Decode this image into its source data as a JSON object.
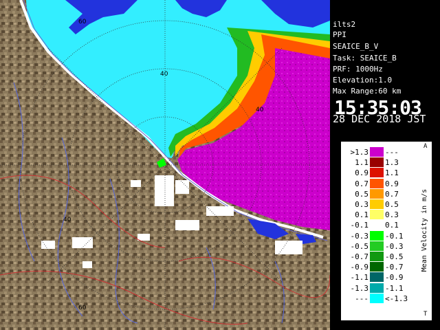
{
  "radar": {
    "ring_labels": [
      "60",
      "40",
      "40",
      "40",
      "60"
    ]
  },
  "info": {
    "site": "ilts2",
    "mode": "PPI",
    "product": "SEAICE_B_V",
    "task": "Task: SEAICE_B",
    "prf": "PRF: 1000Hz",
    "elevation": "Elevation:1.0",
    "max_range": "Max Range:60 km",
    "time": "15:35:03",
    "date": "28 DEC 2018 JST"
  },
  "legend": {
    "title": "Mean Velocity in m/s",
    "corner_top": "A",
    "corner_bottom": "T",
    "rows": [
      {
        "left": ">1.3",
        "right": "---",
        "color": "#cc00cc"
      },
      {
        "left": "1.1",
        "right": "1.3",
        "color": "#990000"
      },
      {
        "left": "0.9",
        "right": "1.1",
        "color": "#dd1100"
      },
      {
        "left": "0.7",
        "right": "0.9",
        "color": "#ff5500"
      },
      {
        "left": "0.5",
        "right": "0.7",
        "color": "#ff9900"
      },
      {
        "left": "0.3",
        "right": "0.5",
        "color": "#ffcc00"
      },
      {
        "left": "0.1",
        "right": "0.3",
        "color": "#ffff66"
      },
      {
        "left": "-0.1",
        "right": "0.1",
        "color": "#ffffff"
      },
      {
        "left": "-0.3",
        "right": "-0.1",
        "color": "#00ff00"
      },
      {
        "left": "-0.5",
        "right": "-0.3",
        "color": "#22cc22"
      },
      {
        "left": "-0.7",
        "right": "-0.5",
        "color": "#119911"
      },
      {
        "left": "-0.9",
        "right": "-0.7",
        "color": "#006600"
      },
      {
        "left": "-1.1",
        "right": "-0.9",
        "color": "#006666"
      },
      {
        "left": "-1.3",
        "right": "-1.1",
        "color": "#00aaaa"
      },
      {
        "left": "---",
        "right": "<-1.3",
        "color": "#00ffff"
      }
    ]
  },
  "colors": {
    "land": "#8c7a5c",
    "sea_ice_cyan": "#33eeff",
    "velocity_magenta": "#cc00cc",
    "blue_echo": "#2233dd",
    "background": "#000000"
  }
}
